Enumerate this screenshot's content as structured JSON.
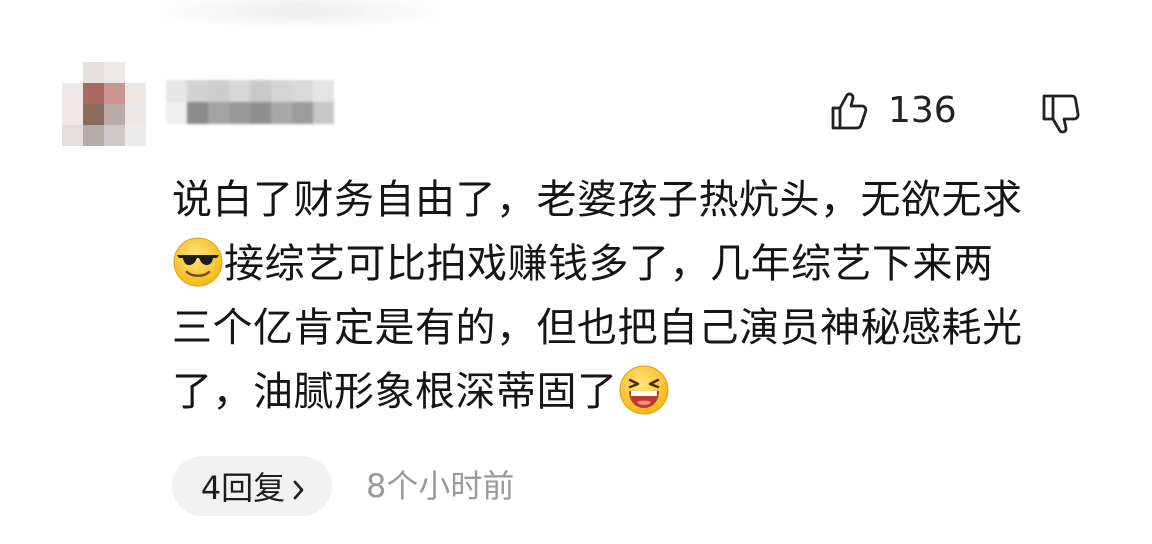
{
  "comment": {
    "likes": "136",
    "text_parts": {
      "line1": "说白了财务自由了，老婆孩子热炕头，无欲无求",
      "line2": "接综艺可比拍戏赚钱多了，几年综艺下来两",
      "line3": "三个亿肯定是有的，但也把自己演员神秘感耗光",
      "line4": "了，油腻形象根深蒂固了"
    },
    "emoji_1": "sunglasses-emoji",
    "emoji_2": "laughing-emoji"
  },
  "footer": {
    "reply_label": "4回复",
    "timestamp": "8个小时前"
  },
  "icons": {
    "like": "thumbs-up-icon",
    "dislike": "thumbs-down-icon",
    "reply_arrow": "chevron-right-icon"
  }
}
